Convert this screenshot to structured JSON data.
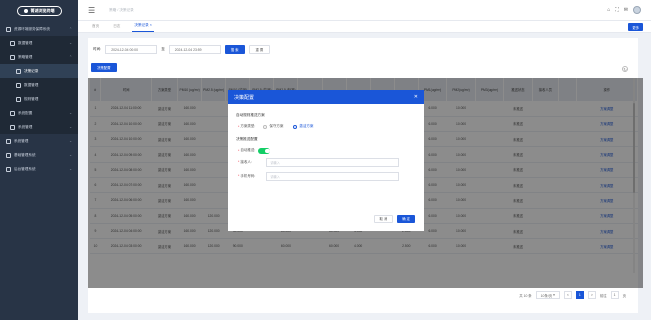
{
  "sidebar": {
    "logo_text": "菁湖浏览终端",
    "items": [
      {
        "label": "资源环境服务保障系统",
        "level": 0,
        "chevron": "^"
      },
      {
        "label": "数据管理",
        "level": 1,
        "chevron": "v"
      },
      {
        "label": "策略管理",
        "level": 1,
        "chevron": "^"
      },
      {
        "label": "决策记录",
        "level": 2,
        "active": true
      },
      {
        "label": "数据管理",
        "level": 2
      },
      {
        "label": "规则管理",
        "level": 2
      },
      {
        "label": "系统配置",
        "level": 1,
        "chevron": "v"
      },
      {
        "label": "系统管理",
        "level": 1,
        "chevron": "v"
      },
      {
        "label": "系统管理",
        "level": 0,
        "chevron": "v"
      },
      {
        "label": "基础管理系统",
        "level": 0,
        "chevron": "v"
      },
      {
        "label": "后台管理系统",
        "level": 0,
        "chevron": "v"
      }
    ]
  },
  "topbar": {
    "crumb": "策略 / 决策记录",
    "icons": [
      "home-icon",
      "fullscreen-icon",
      "message-icon"
    ]
  },
  "tabs": {
    "items": [
      "首页",
      "日志",
      "决策记录"
    ],
    "active_index": 2,
    "right_button": "更多"
  },
  "filter": {
    "time_label": "时间:",
    "start": "2024-12-04 00:00",
    "separator": "至",
    "end": "2024-12-04 23:59",
    "search_btn": "搜 索",
    "reset_btn": "重 置"
  },
  "action_btn": "决策配置",
  "table": {
    "columns": [
      "#",
      "时间",
      "方案类型",
      "PM10 (ug/m³)",
      "PM2.5 (ug/m³)",
      "PM10 (监测)",
      "PM2.5 (监测)",
      "PM2.5 (标准)",
      "",
      "",
      "",
      "",
      "",
      "PM1(ug/m³)",
      "PM2(ug/m³)",
      "PM3(ug/m³)",
      "推送状态",
      "接收人员",
      "",
      "操作"
    ],
    "rows": [
      [
        "1",
        "2024-12-04 11:00:00",
        "激活方案",
        "160.000",
        "",
        "",
        "",
        "",
        "",
        "",
        "",
        "",
        "",
        "6.000",
        "10.000",
        "",
        "未推送",
        "",
        "",
        "方案调整"
      ],
      [
        "2",
        "2024-12-04 10:00:00",
        "激活方案",
        "160.000",
        "",
        "",
        "",
        "",
        "",
        "",
        "",
        "",
        "",
        "6.000",
        "10.000",
        "",
        "未推送",
        "",
        "",
        "方案调整"
      ],
      [
        "3",
        "2024-12-04 10:00:00",
        "激活方案",
        "160.000",
        "",
        "",
        "",
        "",
        "",
        "",
        "",
        "",
        "",
        "6.000",
        "10.000",
        "",
        "未推送",
        "",
        "",
        "方案调整"
      ],
      [
        "4",
        "2024-12-04 09:00:00",
        "激活方案",
        "160.000",
        "",
        "",
        "",
        "",
        "",
        "",
        "",
        "",
        "",
        "6.000",
        "10.000",
        "",
        "未推送",
        "",
        "",
        "方案调整"
      ],
      [
        "5",
        "2024-12-04 08:00:00",
        "激活方案",
        "160.000",
        "",
        "",
        "",
        "",
        "",
        "",
        "",
        "",
        "",
        "6.000",
        "10.000",
        "",
        "未推送",
        "",
        "",
        "方案调整"
      ],
      [
        "6",
        "2024-12-04 07:00:00",
        "激活方案",
        "160.000",
        "",
        "",
        "",
        "",
        "",
        "",
        "",
        "",
        "",
        "6.000",
        "10.000",
        "",
        "未推送",
        "",
        "",
        "方案调整"
      ],
      [
        "7",
        "2024-12-04 06:00:00",
        "激活方案",
        "160.000",
        "",
        "",
        "",
        "",
        "",
        "",
        "",
        "",
        "",
        "6.000",
        "10.000",
        "",
        "未推送",
        "",
        "",
        "方案调整"
      ],
      [
        "8",
        "2024-12-04 05:00:00",
        "激活方案",
        "160.000",
        "120.000",
        "90.000",
        "",
        "60.000",
        "",
        "60.000",
        "4.000",
        "",
        "2.500",
        "6.000",
        "10.000",
        "",
        "未推送",
        "",
        "",
        "方案调整"
      ],
      [
        "9",
        "2024-12-04 04:00:00",
        "激活方案",
        "160.000",
        "120.000",
        "90.000",
        "",
        "60.000",
        "",
        "60.000",
        "4.000",
        "",
        "2.500",
        "6.000",
        "10.000",
        "",
        "未推送",
        "",
        "",
        "方案调整"
      ],
      [
        "10",
        "2024-12-04 03:00:00",
        "激活方案",
        "160.000",
        "120.000",
        "90.000",
        "",
        "60.000",
        "",
        "60.000",
        "4.000",
        "",
        "2.500",
        "6.000",
        "10.000",
        "",
        "未推送",
        "",
        "",
        "方案调整"
      ]
    ]
  },
  "pager": {
    "total": "共 10 条",
    "size": "10条/页",
    "prev": "<",
    "pages": [
      "1"
    ],
    "active_page": "1",
    "next": ">",
    "goto_label": "前往",
    "goto_value": "1",
    "goto_suffix": "页"
  },
  "dialog": {
    "title": "决策配置",
    "section1": "自动规则推送方案",
    "plan_type_label": "方案类型:",
    "radio_options": [
      "保守方案",
      "激活方案"
    ],
    "radio_selected": 1,
    "section2": "决策推送配置",
    "auto_push_label": "自动推送:",
    "auto_push_on": true,
    "receiver_label": "接收人:",
    "receiver_placeholder": "请输入",
    "phone_label": "手机号码:",
    "phone_placeholder": "请输入",
    "cancel_btn": "取 消",
    "confirm_btn": "确 定"
  },
  "colors": {
    "primary": "#1a56d8",
    "sidebar_bg": "#283446",
    "switch_on": "#13ce66"
  }
}
